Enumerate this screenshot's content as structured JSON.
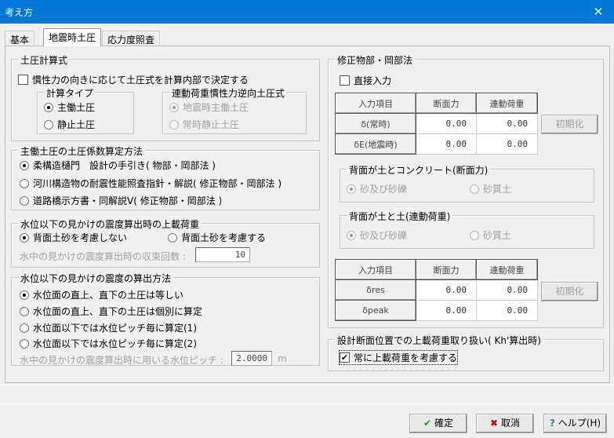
{
  "window": {
    "title": "考え方",
    "close": "✕"
  },
  "tabs": [
    "基本",
    "地震時土圧",
    "応力度照査"
  ],
  "earth_formula": {
    "title": "土圧計算式",
    "checkbox_label": "慣性力の向きに応じて土圧式を計算内部で決定する",
    "checked": false,
    "calc_type": {
      "title": "計算タイプ",
      "options": [
        "主働土圧",
        "静止土圧"
      ],
      "selected": 0
    },
    "reverse": {
      "title": "連動荷重慣性力逆向土圧式",
      "options": [
        "地震時主働土圧",
        "常時静止土圧"
      ],
      "selected": 0
    }
  },
  "coef_method": {
    "title": "主働土圧の土圧係数算定方法",
    "options": [
      "柔構造樋門　設計の手引き( 物部・岡部法 )",
      "河川構造物の耐震性能照査指針・解説( 修正物部・岡部法 )",
      "道路橋示方書・同解説Ⅴ( 修正物部・岡部法 )"
    ],
    "selected": 0
  },
  "surcharge": {
    "title": "水位以下の見かけの震度算出時の上載荷重",
    "options": [
      "背面土砂を考慮しない",
      "背面土砂を考慮する"
    ],
    "selected": 0,
    "iter_label": "水中の見かけの震度算出時の収束回数 :",
    "iter_value": "10"
  },
  "seismic_method": {
    "title": "水位以下の見かけの震度の算出方法",
    "options": [
      "水位面の直上、直下の土圧は等しい",
      "水位面の直上、直下の土圧は個別に算定",
      "水位面以下では水位ピッチ毎に算定(1)",
      "水位面以下では水位ピッチ毎に算定(2)"
    ],
    "selected": 0,
    "pitch_label": "水中の見かけの震度算出時に用いる水位ピッチ :",
    "pitch_value": "2.0000",
    "pitch_unit": "m"
  },
  "modified": {
    "title": "修正物部・岡部法",
    "direct_input": "直接入力",
    "direct_checked": false,
    "table1": {
      "headers": [
        "入力項目",
        "断面力",
        "連動荷重"
      ],
      "rows": [
        [
          "δ(常時)",
          "0.00",
          "0.00"
        ],
        [
          "δE(地震時)",
          "0.00",
          "0.00"
        ]
      ]
    },
    "init_label": "初期化",
    "concrete": {
      "title": "背面が土とコンクリート(断面力)",
      "options": [
        "砂及び砂礫",
        "砂質土"
      ],
      "selected": 0
    },
    "soil": {
      "title": "背面が土と土(連動荷重)",
      "options": [
        "砂及び砂礫",
        "砂質土"
      ],
      "selected": 0
    },
    "table2": {
      "headers": [
        "入力項目",
        "断面力",
        "連動荷重"
      ],
      "rows": [
        [
          "δres",
          "0.00",
          "0.00"
        ],
        [
          "δpeak",
          "0.00",
          "0.00"
        ]
      ]
    }
  },
  "design_surcharge": {
    "title": "設計断面位置での上載荷重取り扱い( Kh'算出時)",
    "checkbox_label": "常に上載荷重を考慮する",
    "checked": true
  },
  "buttons": {
    "ok": "確定",
    "cancel": "取消",
    "help": "ヘルプ(H)"
  }
}
